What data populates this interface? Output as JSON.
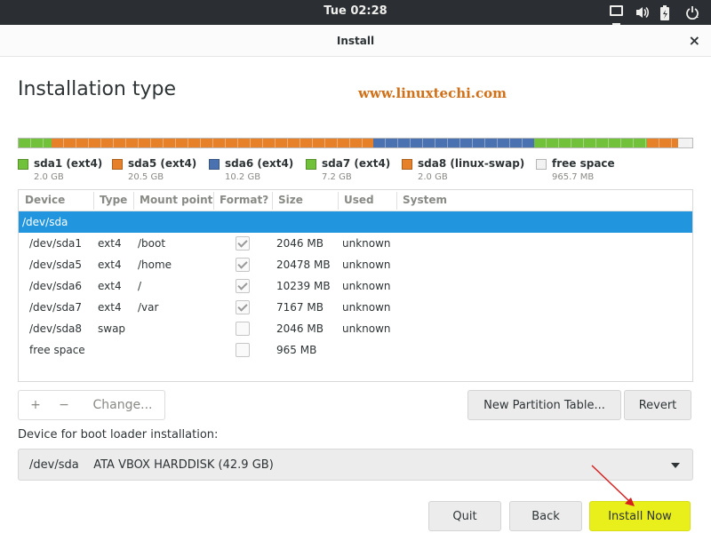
{
  "topbar": {
    "clock": "Tue 02:28",
    "icons": [
      "screen-icon",
      "volume-icon",
      "battery-icon",
      "power-icon"
    ]
  },
  "window": {
    "title": "Install",
    "close_label": "×"
  },
  "page": {
    "heading": "Installation type",
    "watermark": "www.linuxtechi.com"
  },
  "colors": {
    "green": "#72c13a",
    "orange": "#e6812a",
    "blue": "#4a72b0",
    "free": "#f2f2f2",
    "selection": "#2196df",
    "install_button": "#e9ef1a",
    "annotation_arrow": "#d62020"
  },
  "partition_bar": [
    {
      "label": "sda1 (ext4)",
      "size": "2.0 GB",
      "color": "#72c13a"
    },
    {
      "label": "sda5 (ext4)",
      "size": "20.5 GB",
      "color": "#e6812a"
    },
    {
      "label": "sda6 (ext4)",
      "size": "10.2 GB",
      "color": "#4a72b0"
    },
    {
      "label": "sda7 (ext4)",
      "size": "7.2 GB",
      "color": "#72c13a"
    },
    {
      "label": "sda8 (linux-swap)",
      "size": "2.0 GB",
      "color": "#e6812a"
    },
    {
      "label": "free space",
      "size": "965.7 MB",
      "color": "#f2f2f2"
    }
  ],
  "table": {
    "headers": [
      "Device",
      "Type",
      "Mount point",
      "Format?",
      "Size",
      "Used",
      "System"
    ],
    "rows": [
      {
        "device": "/dev/sda",
        "type": "",
        "mount": "",
        "format": null,
        "size": "",
        "used": "",
        "system": "",
        "selected": true
      },
      {
        "device": "/dev/sda1",
        "type": "ext4",
        "mount": "/boot",
        "format": true,
        "size": "2046 MB",
        "used": "unknown",
        "system": ""
      },
      {
        "device": "/dev/sda5",
        "type": "ext4",
        "mount": "/home",
        "format": true,
        "size": "20478 MB",
        "used": "unknown",
        "system": ""
      },
      {
        "device": "/dev/sda6",
        "type": "ext4",
        "mount": "/",
        "format": true,
        "size": "10239 MB",
        "used": "unknown",
        "system": ""
      },
      {
        "device": "/dev/sda7",
        "type": "ext4",
        "mount": "/var",
        "format": true,
        "size": "7167 MB",
        "used": "unknown",
        "system": ""
      },
      {
        "device": "/dev/sda8",
        "type": "swap",
        "mount": "",
        "format": false,
        "size": "2046 MB",
        "used": "unknown",
        "system": ""
      },
      {
        "device": "free space",
        "type": "",
        "mount": "",
        "format": false,
        "size": "965 MB",
        "used": "",
        "system": ""
      }
    ]
  },
  "partition_controls": {
    "add_label": "+",
    "remove_label": "−",
    "change_label": "Change..."
  },
  "buttons": {
    "new_table": "New Partition Table...",
    "revert": "Revert",
    "quit": "Quit",
    "back": "Back",
    "install": "Install Now"
  },
  "bootloader": {
    "label": "Device for boot loader installation:",
    "selected": "/dev/sda    ATA VBOX HARDDISK (42.9 GB)"
  }
}
